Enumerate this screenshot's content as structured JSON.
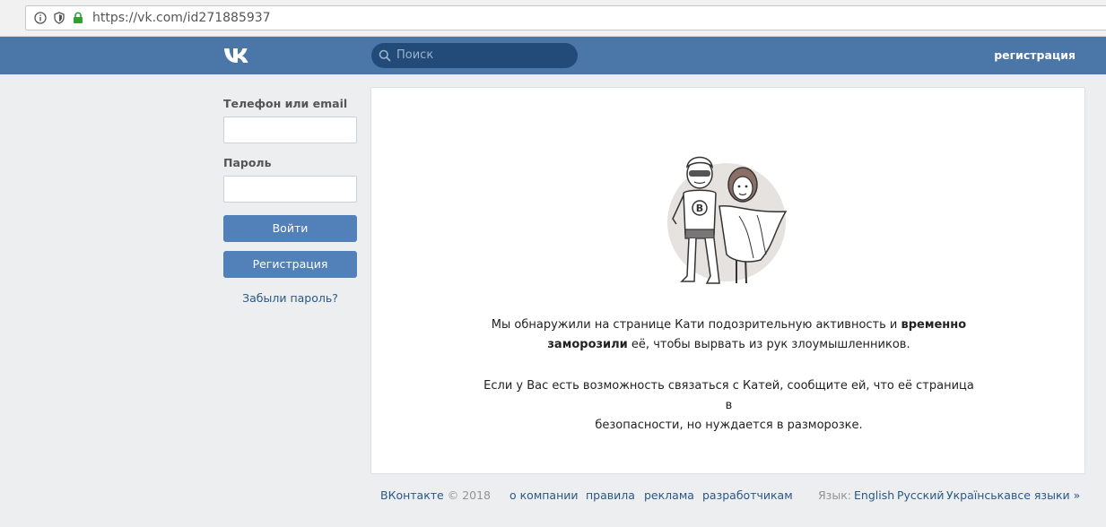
{
  "browser": {
    "url": "https://vk.com/id271885937"
  },
  "header": {
    "search_placeholder": "Поиск",
    "register_link": "регистрация"
  },
  "login": {
    "phone_label": "Телефон или email",
    "password_label": "Пароль",
    "login_button": "Войти",
    "register_button": "Регистрация",
    "forgot_link": "Забыли пароль?"
  },
  "notice": {
    "line1_normal": "Мы обнаружили на странице Кати подозрительную активность и ",
    "line1_bold": "временно",
    "line2_bold": "заморозили",
    "line2_normal": " её, чтобы вырвать из рук злоумышленников.",
    "para2_line1": "Если у Вас есть возможность связаться с Катей, сообщите ей, что её страница в",
    "para2_line2": "безопасности, но нуждается в разморозке."
  },
  "footer": {
    "brand": "ВКонтакте",
    "year": "© 2018",
    "links": [
      "о компании",
      "правила",
      "реклама",
      "разработчикам"
    ],
    "lang_label": "Язык:",
    "languages": [
      "English",
      "Русский",
      "Українська",
      "все языки »"
    ]
  },
  "icons": {
    "info": "info-icon",
    "shield": "shield-icon",
    "lock": "lock-icon",
    "search": "search-icon",
    "logo": "vk-logo-icon"
  },
  "colors": {
    "header": "#4a76a8",
    "button": "#5181b8",
    "link": "#2a5885",
    "background": "#edeef0"
  }
}
